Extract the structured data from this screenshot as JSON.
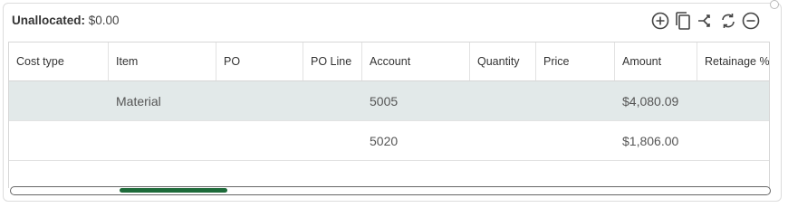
{
  "summary": {
    "label": "Unallocated:",
    "value": "$0.00"
  },
  "toolbar": {
    "icons": [
      "add-circle-icon",
      "copy-icon",
      "split-icon",
      "refresh-icon",
      "remove-circle-icon"
    ],
    "accent": "#444444"
  },
  "table": {
    "columns": [
      "Cost type",
      "Item",
      "PO",
      "PO Line",
      "Account",
      "Quantity",
      "Price",
      "Amount",
      "Retainage %"
    ],
    "rows": [
      [
        "",
        "Material",
        "",
        "",
        "5005",
        "",
        "",
        "$4,080.09",
        ""
      ],
      [
        "",
        "",
        "",
        "",
        "5020",
        "",
        "",
        "$1,806.00",
        ""
      ]
    ],
    "selected_row_color": "#e2e9e9"
  },
  "scrollbar": {
    "thumb_color": "#1e6b3a",
    "position": 0.14
  }
}
